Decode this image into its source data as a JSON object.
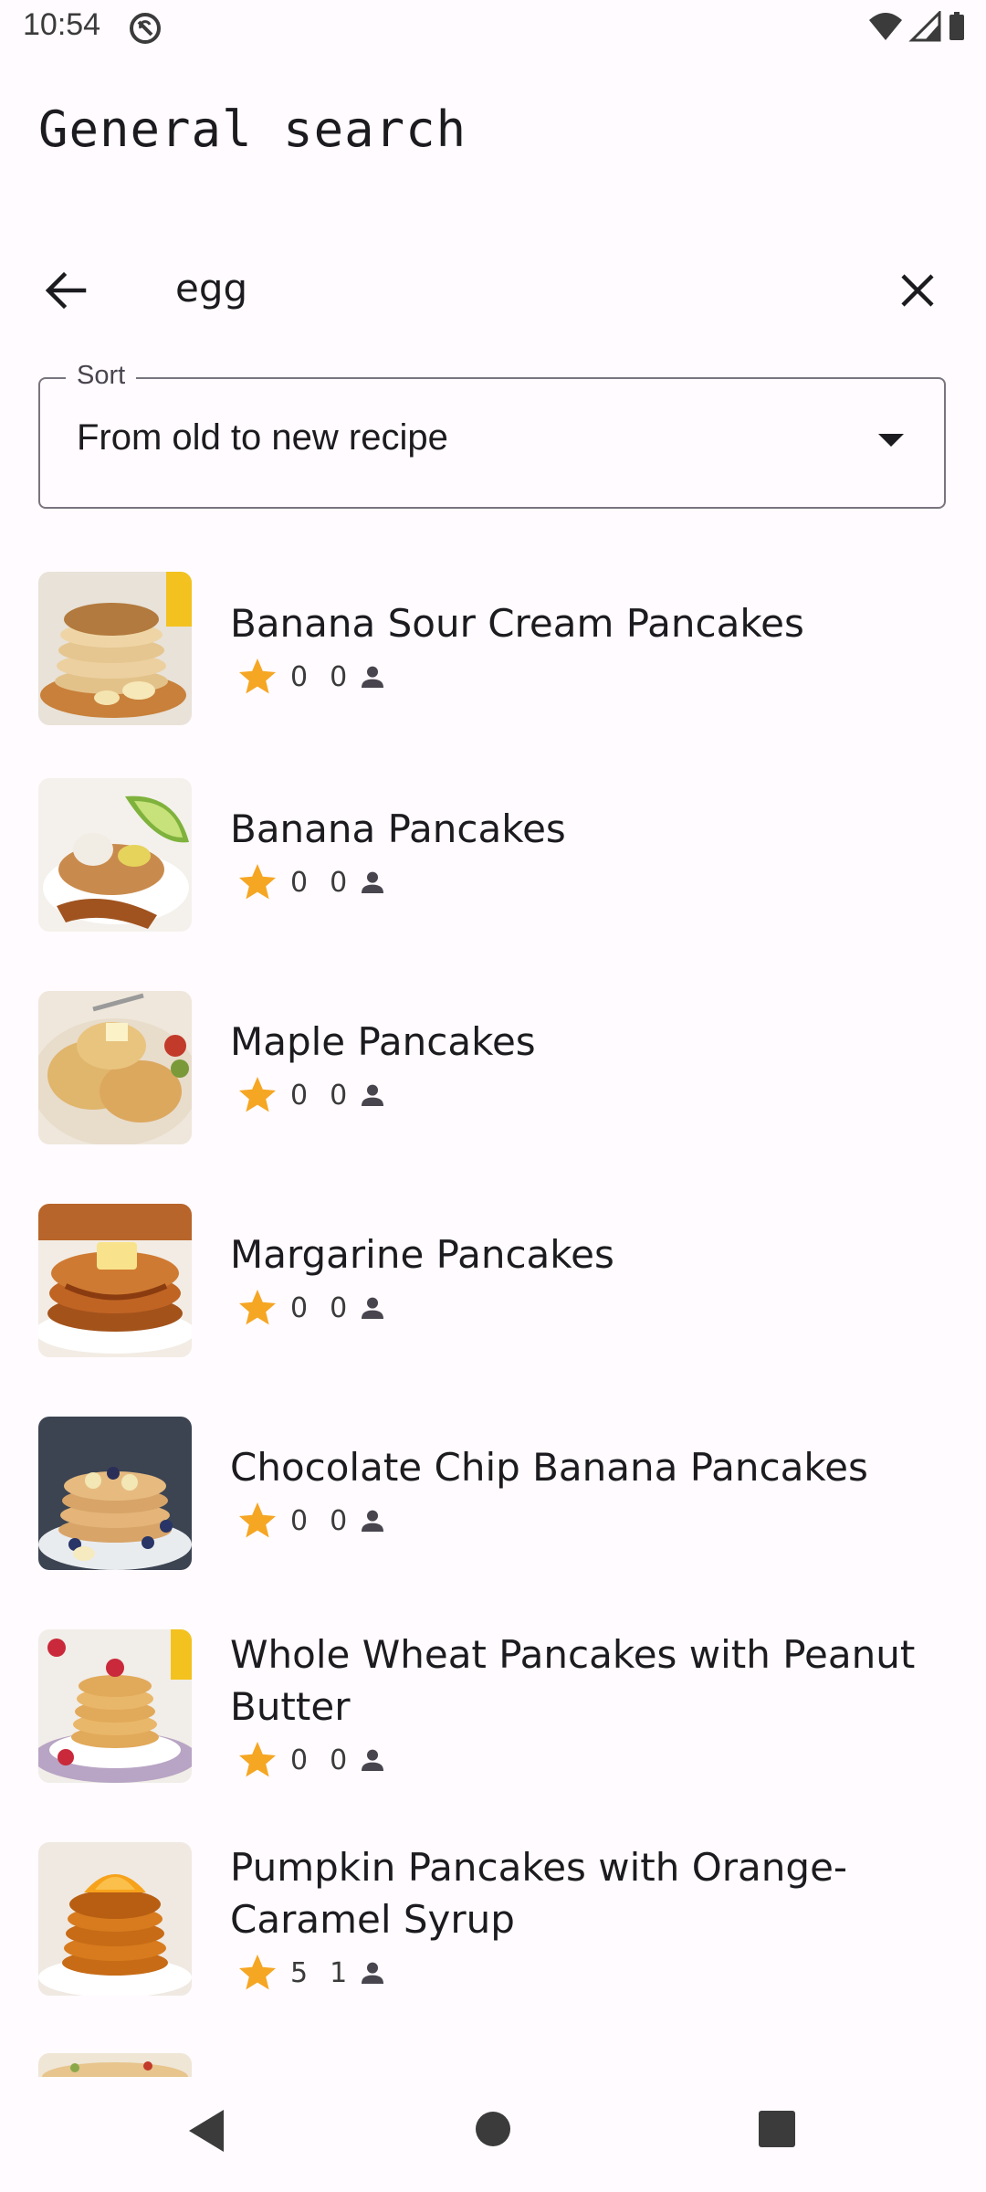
{
  "status": {
    "time": "10:54"
  },
  "page": {
    "title": "General search"
  },
  "search": {
    "query": "egg"
  },
  "sort": {
    "label": "Sort",
    "value": "From old to new recipe"
  },
  "colors": {
    "star": "#f5a623",
    "text": "#1c1b1f",
    "outline": "#79747e",
    "background": "#fffbfe"
  },
  "recipes": [
    {
      "title": "Banana Sour Cream Pancakes",
      "rating": "0",
      "count": "0"
    },
    {
      "title": "Banana Pancakes",
      "rating": "0",
      "count": "0"
    },
    {
      "title": "Maple Pancakes",
      "rating": "0",
      "count": "0"
    },
    {
      "title": "Margarine Pancakes",
      "rating": "0",
      "count": "0"
    },
    {
      "title": "Chocolate Chip Banana Pancakes",
      "rating": "0",
      "count": "0"
    },
    {
      "title": "Whole Wheat Pancakes with Peanut Butter",
      "rating": "0",
      "count": "0"
    },
    {
      "title": "Pumpkin Pancakes with Orange-Caramel Syrup",
      "rating": "5",
      "count": "1"
    }
  ]
}
